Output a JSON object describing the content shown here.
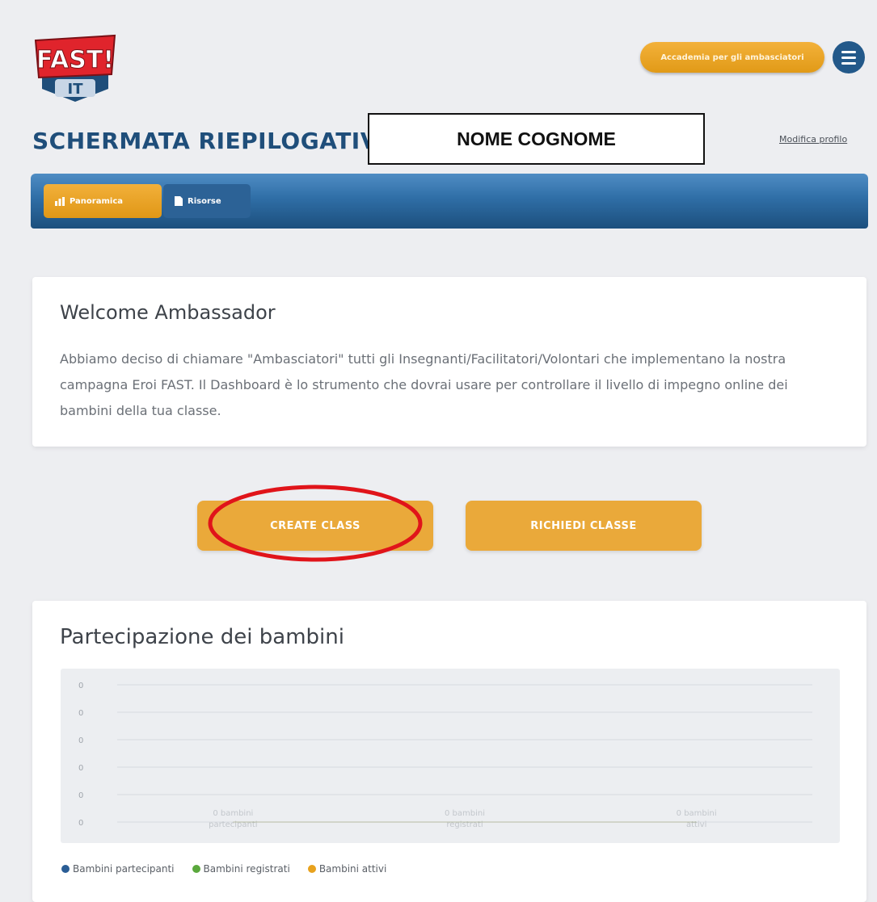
{
  "header": {
    "logo": {
      "line1": "FAST!",
      "line2": "IT"
    },
    "academy_button": "Accademia per gli ambasciatori",
    "menu_icon": "hamburger-menu-icon",
    "page_title": "SCHERMATA RIEPILOGATIVA",
    "name_box": "NOME COGNOME",
    "edit_profile": "Modifica profilo"
  },
  "nav": {
    "tabs": [
      {
        "label": "Panoramica",
        "icon": "chart-icon",
        "active": true
      },
      {
        "label": "Risorse",
        "icon": "document-icon",
        "active": false
      }
    ]
  },
  "welcome": {
    "title": "Welcome Ambassador",
    "text": "Abbiamo deciso di chiamare \"Ambasciatori\" tutti gli Insegnanti/Facilitatori/Volontari che implementano la nostra campagna Eroi FAST. Il Dashboard è lo strumento che dovrai usare per controllare il livello di impegno online dei bambini della tua classe."
  },
  "actions": {
    "create_class": "CREATE CLASS",
    "request_class": "RICHIEDI CLASSE"
  },
  "colors": {
    "accent": "#eaa93a",
    "nav_blue": "#2f6ea6",
    "title_blue": "#1f4e7a",
    "highlight_red": "#e0141a"
  },
  "participation": {
    "title": "Partecipazione dei bambini",
    "chart_data": {
      "type": "line",
      "title": "Partecipazione dei bambini",
      "y_ticks": [
        "0",
        "0",
        "0",
        "0",
        "0",
        "0"
      ],
      "categories": [
        [
          "0 bambini",
          "partecipanti"
        ],
        [
          "0 bambini",
          "registrati"
        ],
        [
          "0 bambini",
          "attivi"
        ]
      ],
      "series": [
        {
          "name": "Bambini partecipanti",
          "color": "#2a5d95",
          "values": [
            0,
            0,
            0
          ]
        },
        {
          "name": "Bambini registrati",
          "color": "#5aa83c",
          "values": [
            0,
            0,
            0
          ]
        },
        {
          "name": "Bambini attivi",
          "color": "#e8a21e",
          "values": [
            0,
            0,
            0
          ]
        }
      ],
      "ylim": [
        0,
        0
      ],
      "grid": true,
      "legend": "bottom-left"
    }
  }
}
